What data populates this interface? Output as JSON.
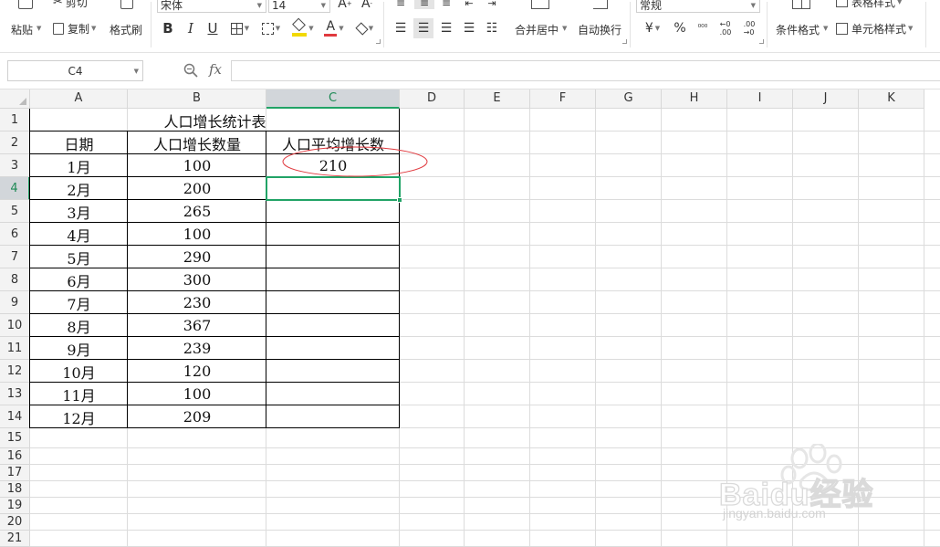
{
  "ribbon": {
    "paste": "粘贴",
    "cut": "剪切",
    "copy": "复制",
    "format_painter": "格式刷",
    "font_name": "宋体",
    "font_size": "14",
    "merge_center": "合并居中",
    "wrap_text": "自动换行",
    "number_format": "常规",
    "currency_symbol": "¥",
    "percent_symbol": "%",
    "conditional_format": "条件格式",
    "table_style": "表格样式",
    "cell_style": "单元格样式"
  },
  "formula_bar": {
    "name_box": "C4",
    "fx": "fx",
    "formula": ""
  },
  "grid": {
    "columns": [
      "A",
      "B",
      "C",
      "D",
      "E",
      "F",
      "G",
      "H",
      "I",
      "J",
      "K"
    ],
    "rows": [
      "1",
      "2",
      "3",
      "4",
      "5",
      "6",
      "7",
      "8",
      "9",
      "10",
      "11",
      "12",
      "13",
      "14",
      "15",
      "16",
      "17",
      "18",
      "19",
      "20",
      "21"
    ],
    "active_column": "C",
    "active_row": "4"
  },
  "table": {
    "title": "人口增长统计表",
    "headers": [
      "日期",
      "人口增长数量",
      "人口平均增长数"
    ],
    "rows": [
      {
        "month": "1月",
        "count": "100",
        "avg": "210"
      },
      {
        "month": "2月",
        "count": "200",
        "avg": ""
      },
      {
        "month": "3月",
        "count": "265",
        "avg": ""
      },
      {
        "month": "4月",
        "count": "100",
        "avg": ""
      },
      {
        "month": "5月",
        "count": "290",
        "avg": ""
      },
      {
        "month": "6月",
        "count": "300",
        "avg": ""
      },
      {
        "month": "7月",
        "count": "230",
        "avg": ""
      },
      {
        "month": "8月",
        "count": "367",
        "avg": ""
      },
      {
        "month": "9月",
        "count": "239",
        "avg": ""
      },
      {
        "month": "10月",
        "count": "120",
        "avg": ""
      },
      {
        "month": "11月",
        "count": "100",
        "avg": ""
      },
      {
        "month": "12月",
        "count": "209",
        "avg": ""
      }
    ]
  },
  "colors": {
    "selection": "#21a366",
    "annotation": "#e0393e",
    "underline_yellow": "#f2d900",
    "font_red": "#e0393e"
  },
  "watermark": {
    "brand": "Baidu经验",
    "url": "jingyan.baidu.com"
  }
}
